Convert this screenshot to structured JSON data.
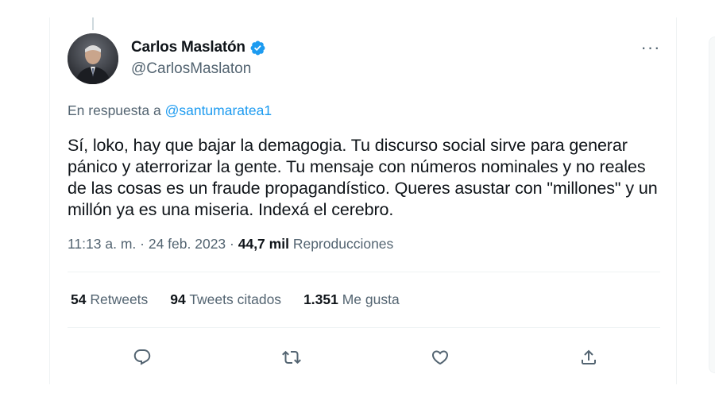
{
  "tweet": {
    "author": {
      "display_name": "Carlos Maslatón",
      "handle": "@CarlosMaslaton",
      "verified_icon": "verified-badge-icon"
    },
    "more_icon_glyph": "···",
    "reply_to": {
      "prefix": "En respuesta a",
      "mention": "@santumaratea1"
    },
    "text": "Sí, loko, hay que bajar la demagogia. Tu discurso social sirve para generar pánico y aterrorizar la gente. Tu mensaje con números nominales y no reales de las cosas es un fraude propagandístico. Queres asustar con \"millones\" y un millón ya es una miseria. Indexá el cerebro.",
    "meta": {
      "time": "11:13 a. m.",
      "separator": "·",
      "date": "24 feb. 2023",
      "views_count": "44,7 mil",
      "views_label": "Reproducciones"
    },
    "stats": [
      {
        "count": "54",
        "label": "Retweets"
      },
      {
        "count": "94",
        "label": "Tweets citados"
      },
      {
        "count": "1.351",
        "label": "Me gusta"
      }
    ],
    "actions": [
      {
        "name": "reply",
        "icon": "reply-icon"
      },
      {
        "name": "retweet",
        "icon": "retweet-icon"
      },
      {
        "name": "like",
        "icon": "heart-icon"
      },
      {
        "name": "share",
        "icon": "share-icon"
      }
    ]
  },
  "colors": {
    "text_primary": "#0f1419",
    "text_secondary": "#536471",
    "link_blue": "#1d9bf0",
    "border": "#eff3f4"
  }
}
